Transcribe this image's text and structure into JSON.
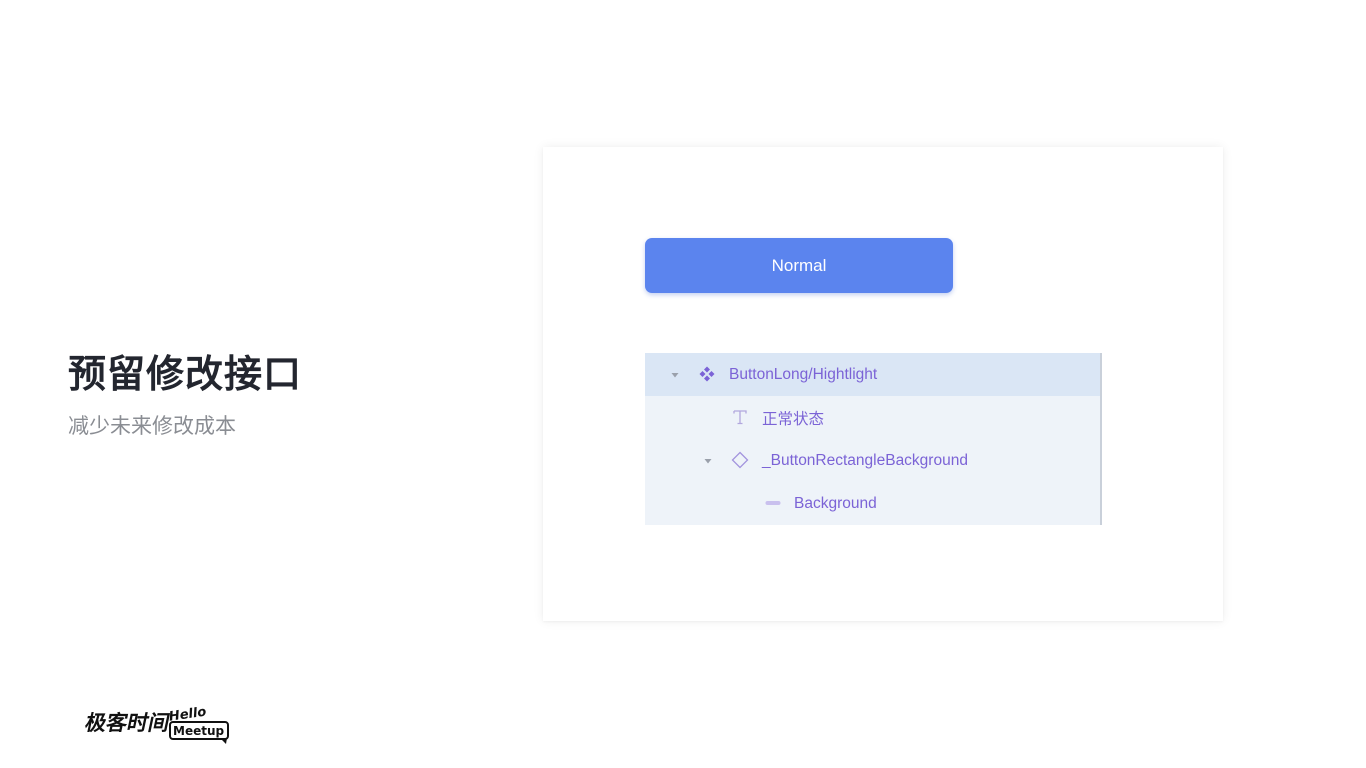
{
  "slide": {
    "title": "预留修改接口",
    "subtitle": "减少未来修改成本"
  },
  "preview": {
    "button_label": "Normal",
    "layers": [
      {
        "label": "ButtonLong/Hightlight",
        "icon": "component-icon",
        "expanded": true,
        "selected": true
      },
      {
        "label": "正常状态",
        "icon": "text-icon",
        "expanded": null,
        "selected": false
      },
      {
        "label": "_ButtonRectangleBackground",
        "icon": "instance-icon",
        "expanded": true,
        "selected": false
      },
      {
        "label": "Background",
        "icon": "rectangle-icon",
        "expanded": null,
        "selected": false
      }
    ]
  },
  "footer": {
    "logos": [
      "极客时间",
      "Hello Meetup"
    ]
  },
  "colors": {
    "button": "#5b84ee",
    "layer_text": "#7b63d6",
    "layer_panel": "#eef3f9",
    "layer_selected": "#dae6f5",
    "title": "#23262f",
    "subtitle": "#8a8d93"
  }
}
